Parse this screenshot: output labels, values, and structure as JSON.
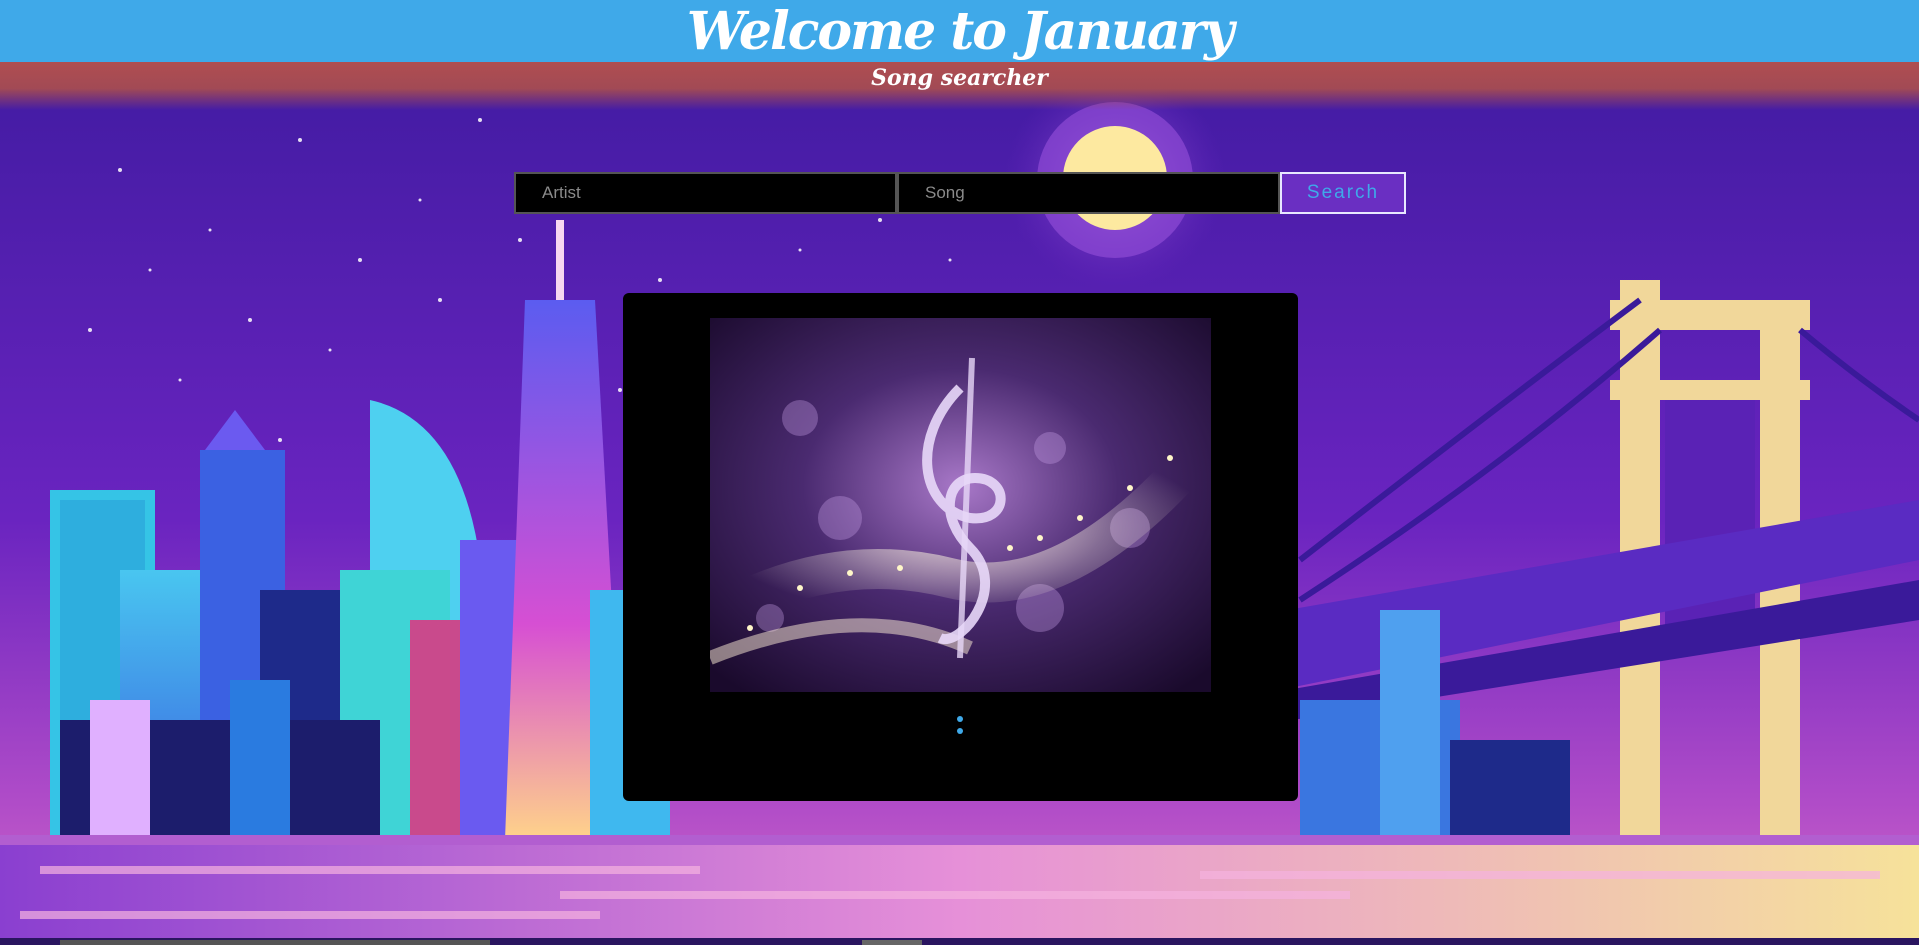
{
  "header": {
    "title": "Welcome to January",
    "subtitle": "Song searcher"
  },
  "search": {
    "artist_placeholder": "Artist",
    "artist_value": "",
    "song_placeholder": "Song",
    "song_value": "",
    "button_label": "Search"
  },
  "carousel": {
    "image": "music-notes-treble-clef",
    "indicator_count": 2
  },
  "colors": {
    "header_bg": "#3fa9e9",
    "subheader_bg": "#b04e50",
    "accent": "#3fa9e9",
    "button_bg": "#6a2fc2"
  }
}
